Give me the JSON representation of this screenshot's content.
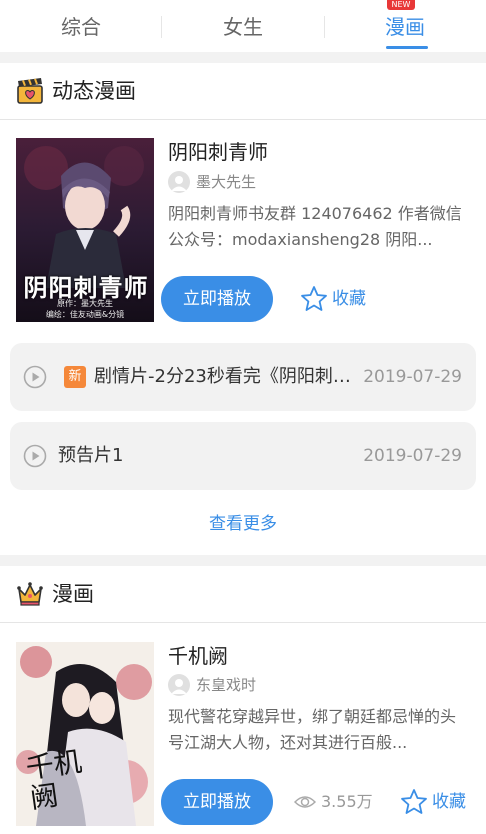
{
  "tabs": [
    {
      "label": "综合"
    },
    {
      "label": "女生"
    },
    {
      "label": "漫画",
      "badge": "NEW"
    }
  ],
  "dynamic_section": {
    "title": "动态漫画",
    "icon": "clapperboard-heart-icon",
    "item": {
      "title": "阴阳刺青师",
      "author": "墨大先生",
      "description": "阴阳刺青师书友群 124076462 作者微信公众号：modaxiansheng28 阴阳...",
      "play_label": "立即播放",
      "fav_label": "收藏",
      "cover_text": "阴阳刺青师",
      "cover_sub1": "原作：墨大先生",
      "cover_sub2": "编绘：佳友动画&分镜"
    },
    "episodes": [
      {
        "is_new": true,
        "new_label": "新",
        "title": "剧情片-2分23秒看完《阴阳刺…",
        "date": "2019-07-29"
      },
      {
        "is_new": false,
        "title": "预告片1",
        "date": "2019-07-29"
      }
    ],
    "more_label": "查看更多"
  },
  "comic_section": {
    "title": "漫画",
    "icon": "crown-icon",
    "item": {
      "title": "千机阙",
      "author": "东皇戏时",
      "description": "现代警花穿越异世，绑了朝廷都忌惮的头号江湖大人物，还对其进行百般...",
      "play_label": "立即播放",
      "views": "3.55万",
      "fav_label": "收藏",
      "cover_text": "千机阙"
    }
  },
  "colors": {
    "accent": "#3a8ee6",
    "new_tag": "#f5883a",
    "badge": "#e83838"
  }
}
